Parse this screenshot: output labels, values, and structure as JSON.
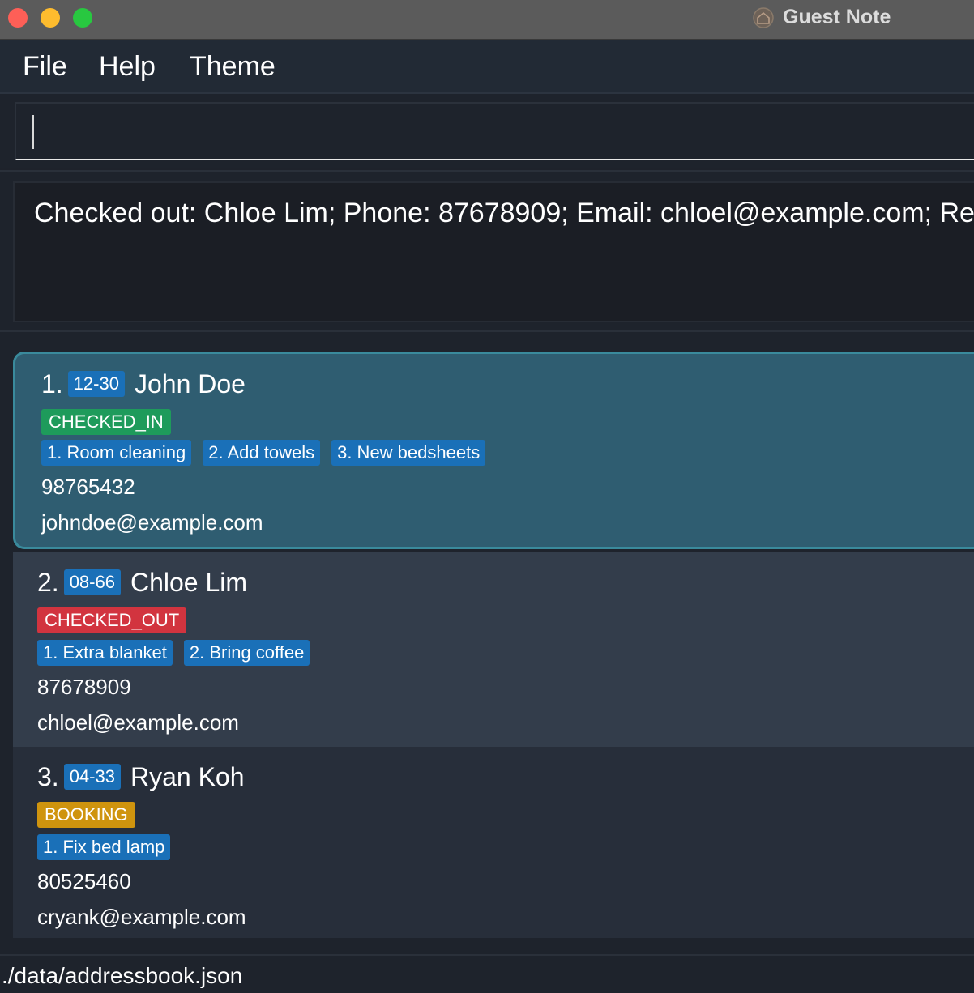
{
  "window": {
    "title": "Guest Note",
    "icon": "house-icon"
  },
  "menu": {
    "items": [
      {
        "label": "File"
      },
      {
        "label": "Help"
      },
      {
        "label": "Theme"
      }
    ]
  },
  "command_box": {
    "value": "",
    "placeholder": ""
  },
  "result_display": {
    "text": "Checked out: Chloe Lim; Phone: 87678909; Email: chloel@example.com; Reque"
  },
  "guests": [
    {
      "index": "1.",
      "room": "12-30",
      "name": "John Doe",
      "status": "CHECKED_IN",
      "requests": [
        "1. Room cleaning",
        "2. Add towels",
        "3. New bedsheets"
      ],
      "phone": "98765432",
      "email": "johndoe@example.com",
      "selected": true
    },
    {
      "index": "2.",
      "room": "08-66",
      "name": "Chloe Lim",
      "status": "CHECKED_OUT",
      "requests": [
        "1. Extra blanket",
        "2. Bring coffee"
      ],
      "phone": "87678909",
      "email": "chloel@example.com",
      "selected": false
    },
    {
      "index": "3.",
      "room": "04-33",
      "name": "Ryan Koh",
      "status": "BOOKING",
      "requests": [
        "1. Fix bed lamp"
      ],
      "phone": "80525460",
      "email": "cryank@example.com",
      "selected": false
    }
  ],
  "status_bar": {
    "path": "./data/addressbook.json"
  },
  "colors": {
    "checked_in": "#1e9b5b",
    "checked_out": "#d2343f",
    "booking": "#cf940e",
    "tag_blue": "#1a70b8",
    "selected_card": "#2f5d71"
  }
}
